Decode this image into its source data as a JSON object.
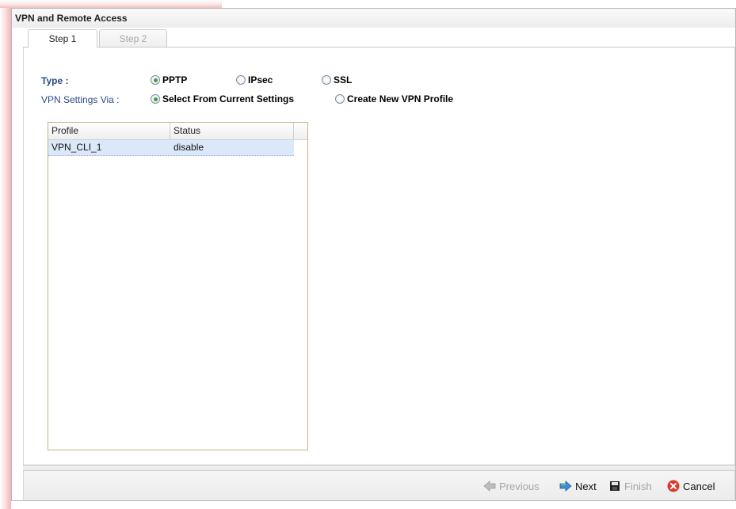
{
  "window": {
    "title": "VPN and Remote Access"
  },
  "tabs": [
    {
      "label": "Step 1",
      "active": true
    },
    {
      "label": "Step 2",
      "active": false
    }
  ],
  "form": {
    "type_label": "Type :",
    "type_options": [
      {
        "label": "PPTP",
        "checked": true
      },
      {
        "label": "IPsec",
        "checked": false
      },
      {
        "label": "SSL",
        "checked": false
      }
    ],
    "via_label": "VPN Settings Via :",
    "via_options": [
      {
        "label": "Select From Current Settings",
        "checked": true
      },
      {
        "label": "Create New VPN Profile",
        "checked": false
      }
    ]
  },
  "profile_table": {
    "columns": [
      "Profile",
      "Status"
    ],
    "rows": [
      {
        "profile": "VPN_CLI_1",
        "status": "disable",
        "selected": true
      }
    ]
  },
  "footer": {
    "previous_label": "Previous",
    "next_label": "Next",
    "finish_label": "Finish",
    "cancel_label": "Cancel"
  },
  "colors": {
    "label_blue": "#2b4a86",
    "radio_checked_green": "#3fa13f",
    "selected_row": "#dbe8fa",
    "cancel_red": "#d93a2b"
  }
}
